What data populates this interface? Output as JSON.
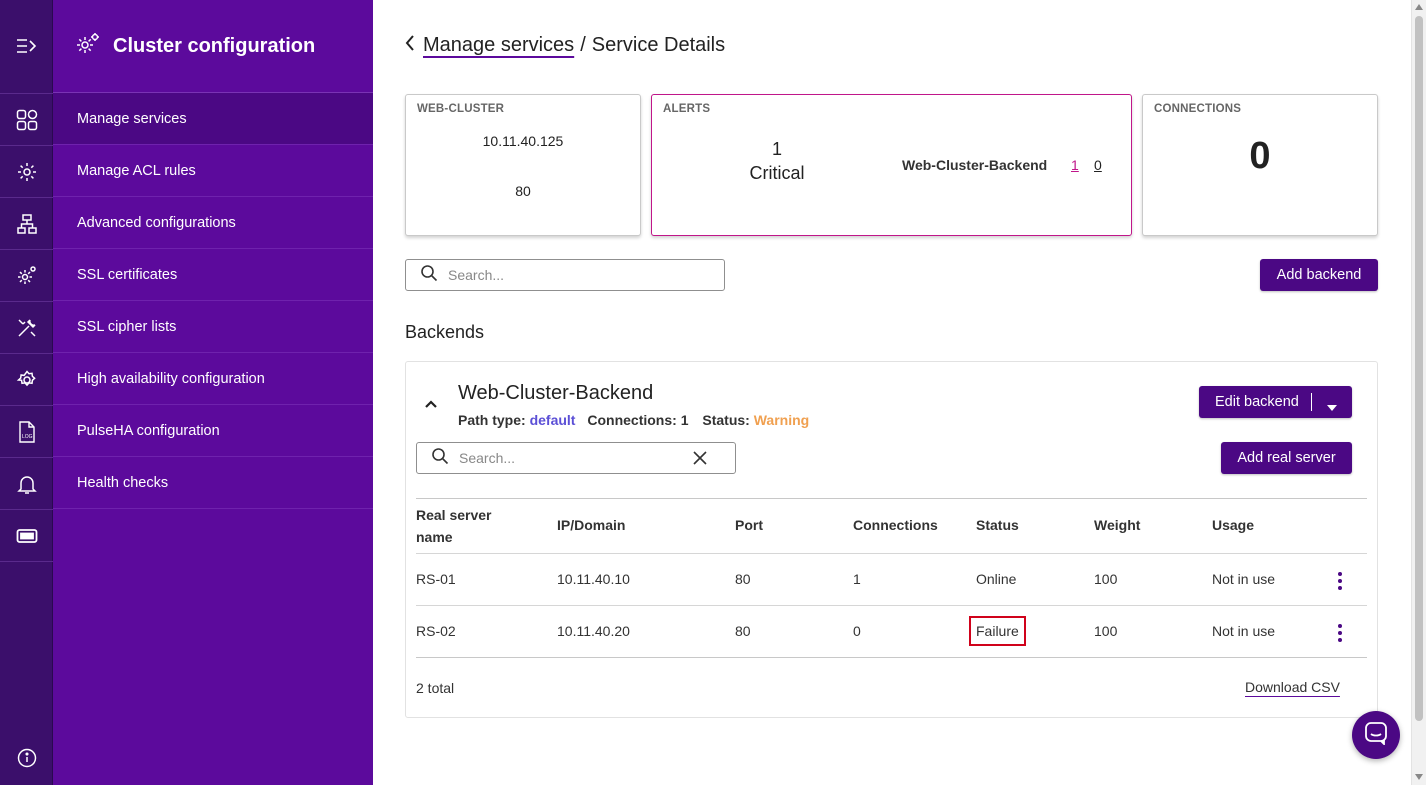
{
  "rail": {
    "icons": [
      "expand-icon",
      "dashboard-icon",
      "acl-gear-icon",
      "network-icon",
      "ssl-gear-icon",
      "tools-icon",
      "settings-icon",
      "log-file-icon",
      "bell-icon",
      "ticket-icon",
      "info-icon"
    ]
  },
  "nav": {
    "title": "Cluster configuration",
    "items": [
      {
        "label": "Manage services",
        "active": true
      },
      {
        "label": "Manage ACL rules"
      },
      {
        "label": "Advanced configurations"
      },
      {
        "label": "SSL certificates"
      },
      {
        "label": "SSL cipher lists"
      },
      {
        "label": "High availability configuration"
      },
      {
        "label": "PulseHA configuration"
      },
      {
        "label": "Health checks"
      }
    ]
  },
  "breadcrumb": {
    "parent": "Manage services",
    "separator": "/",
    "current": "Service Details"
  },
  "cards": {
    "cluster": {
      "label": "WEB-CLUSTER",
      "ip": "10.11.40.125",
      "port": "80"
    },
    "alerts": {
      "label": "ALERTS",
      "count": "1",
      "severity": "Critical",
      "backend": "Web-Cluster-Backend",
      "link_a": "1",
      "link_b": "0"
    },
    "connections": {
      "label": "CONNECTIONS",
      "value": "0"
    }
  },
  "search_top": {
    "placeholder": "Search..."
  },
  "add_backend": "Add backend",
  "section_title": "Backends",
  "backend": {
    "name": "Web-Cluster-Backend",
    "path_type_label": "Path type:",
    "path_type_value": "default",
    "connections_label": "Connections: 1",
    "status_label": "Status:",
    "status_value": "Warning",
    "edit_button": "Edit backend",
    "add_real_server": "Add real server",
    "search_placeholder": "Search...",
    "columns": [
      "Real server\nname",
      "IP/Domain",
      "Port",
      "Connections",
      "Status",
      "Weight",
      "Usage"
    ],
    "rows": [
      {
        "name": "RS-01",
        "ip": "10.11.40.10",
        "port": "80",
        "connections": "1",
        "status": "Online",
        "weight": "100",
        "usage": "Not in use"
      },
      {
        "name": "RS-02",
        "ip": "10.11.40.20",
        "port": "80",
        "connections": "0",
        "status": "Failure",
        "weight": "100",
        "usage": "Not in use"
      }
    ],
    "total": "2 total",
    "download": "Download CSV"
  },
  "colors": {
    "rail": "#3b0f6b",
    "nav": "#5c0a9c",
    "button": "#4b0884",
    "alert_border": "#c0168a",
    "link_pink": "#c0168a",
    "path_type": "#5b4fd6",
    "warning": "#f0a050",
    "failure_box": "#d0021b"
  }
}
